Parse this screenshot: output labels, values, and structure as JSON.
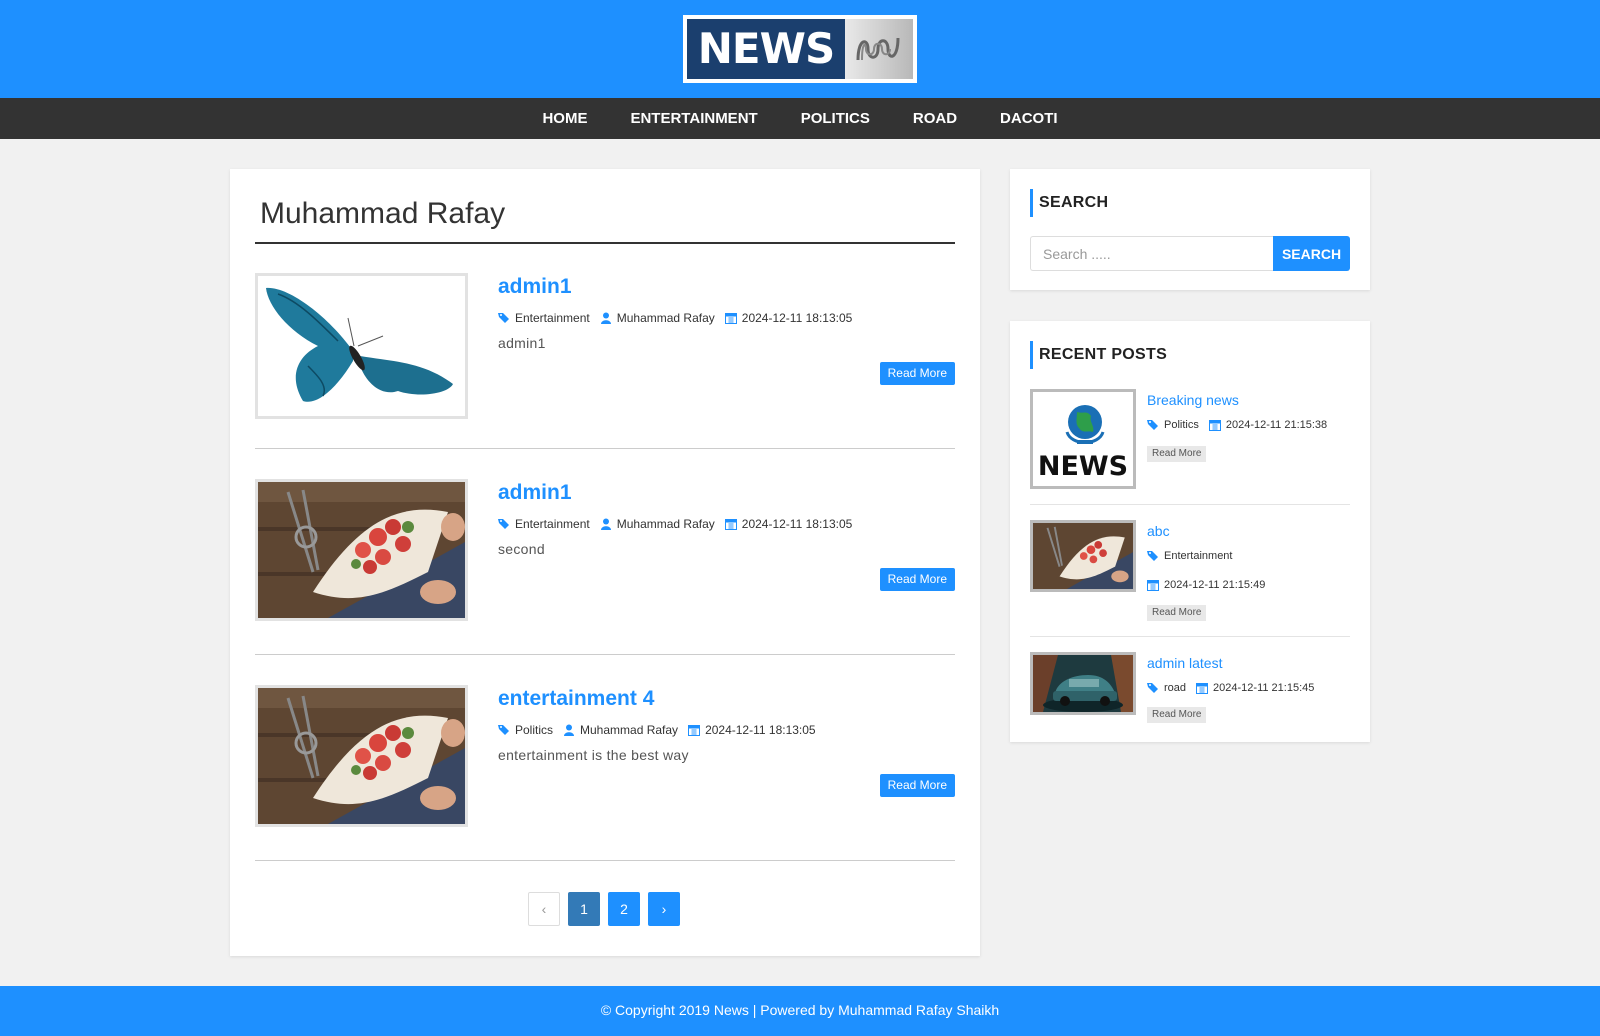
{
  "site": {
    "logo_text": "NEWS",
    "logo_mark": "ꝏꝏ"
  },
  "nav": {
    "items": [
      "HOME",
      "ENTERTAINMENT",
      "POLITICS",
      "ROAD",
      "DACOTI"
    ]
  },
  "main": {
    "page_title": "Muhammad Rafay",
    "posts": [
      {
        "title": "admin1",
        "category": "Entertainment",
        "author": "Muhammad Rafay",
        "date": "2024-12-11 18:13:05",
        "excerpt": "admin1",
        "read_more": "Read More",
        "image": "butterfly"
      },
      {
        "title": "admin1",
        "category": "Entertainment",
        "author": "Muhammad Rafay",
        "date": "2024-12-11 18:13:05",
        "excerpt": "second",
        "read_more": "Read More",
        "image": "flowers"
      },
      {
        "title": "entertainment 4",
        "category": "Politics",
        "author": "Muhammad Rafay",
        "date": "2024-12-11 18:13:05",
        "excerpt": "entertainment is the best way",
        "read_more": "Read More",
        "image": "flowers"
      }
    ],
    "pagination": {
      "prev": "‹",
      "pages": [
        "1",
        "2"
      ],
      "current_page": 1,
      "next": "›"
    }
  },
  "sidebar": {
    "search": {
      "title": "SEARCH",
      "placeholder": "Search .....",
      "button": "SEARCH"
    },
    "recent": {
      "title": "RECENT POSTS",
      "posts": [
        {
          "title": "Breaking news",
          "category": "Politics",
          "date": "2024-12-11 21:15:38",
          "read_more": "Read More",
          "image": "news-logo",
          "image_text": "NEWS"
        },
        {
          "title": "abc",
          "category": "Entertainment",
          "date": "2024-12-11 21:15:49",
          "read_more": "Read More",
          "image": "flowers"
        },
        {
          "title": "admin latest",
          "category": "road",
          "date": "2024-12-11 21:15:45",
          "read_more": "Read More",
          "image": "car"
        }
      ]
    }
  },
  "footer": {
    "text": "© Copyright 2019 News | Powered by Muhammad Rafay Shaikh"
  },
  "colors": {
    "accent": "#1e90ff",
    "nav_bg": "#333333",
    "page_bg": "#f1f1f1",
    "active_page": "#337ab7"
  },
  "icons": {
    "category": "tags-icon",
    "author": "user-icon",
    "date": "calendar-icon"
  }
}
